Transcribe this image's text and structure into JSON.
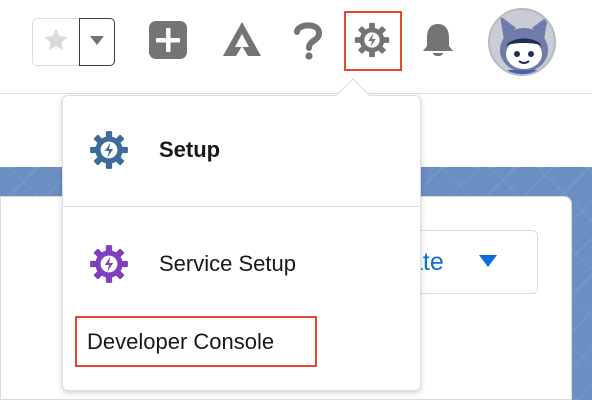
{
  "header": {
    "icons": {
      "favorite": "star-icon",
      "favorites_menu": "chevron-down-icon",
      "global_actions": "plus-icon",
      "trailhead": "trailhead-icon",
      "help": "question-icon",
      "setup": "gear-icon",
      "notifications": "bell-icon",
      "avatar": "astro-avatar"
    }
  },
  "dropdown": {
    "items": [
      {
        "label": "Setup",
        "icon": "gear-icon",
        "icon_color": "#3e6b9c"
      },
      {
        "label": "Service Setup",
        "icon": "gear-icon",
        "icon_color": "#7f3fbf"
      },
      {
        "label": "Developer Console"
      }
    ]
  },
  "background": {
    "button_label": "ate"
  },
  "colors": {
    "highlight": "#e04a2e",
    "header_icon": "#747474",
    "link_blue": "#0b6fd6",
    "page_bg": "#6b8fc3"
  }
}
